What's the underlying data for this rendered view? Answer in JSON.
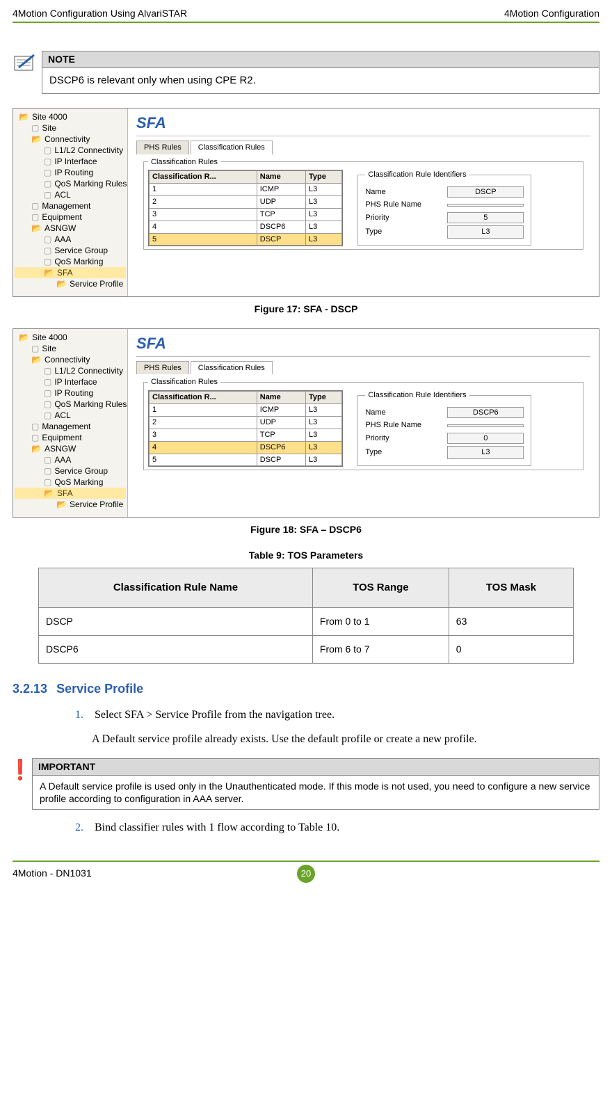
{
  "header": {
    "left": "4Motion Configuration Using AlvariSTAR",
    "right": "4Motion Configuration"
  },
  "note": {
    "title": "NOTE",
    "body": "DSCP6 is relevant only when using CPE R2."
  },
  "figure17": {
    "caption": "Figure 17: SFA - DSCP",
    "title": "SFA",
    "tabs": {
      "t1": "PHS Rules",
      "t2": "Classification Rules"
    },
    "grouplabel": "Classification Rules",
    "tree": {
      "site": "Site 4000",
      "site_item": "Site",
      "conn": "Connectivity",
      "l1l2": "L1/L2 Connectivity",
      "ipif": "IP Interface",
      "iprt": "IP Routing",
      "qosm": "QoS Marking Rules",
      "acl": "ACL",
      "mgmt": "Management",
      "equip": "Equipment",
      "asngw": "ASNGW",
      "aaa": "AAA",
      "sg": "Service Group",
      "qosm2": "QoS Marking",
      "sfa": "SFA",
      "sprof": "Service Profile"
    },
    "cols": {
      "c1": "Classification R...",
      "c2": "Name",
      "c3": "Type"
    },
    "rows": [
      {
        "n": "1",
        "name": "ICMP",
        "type": "L3"
      },
      {
        "n": "2",
        "name": "UDP",
        "type": "L3"
      },
      {
        "n": "3",
        "name": "TCP",
        "type": "L3"
      },
      {
        "n": "4",
        "name": "DSCP6",
        "type": "L3"
      },
      {
        "n": "5",
        "name": "DSCP",
        "type": "L3"
      }
    ],
    "highlight_index": 4,
    "ident": {
      "title": "Classification Rule Identifiers",
      "name_lbl": "Name",
      "name_val": "DSCP",
      "phs_lbl": "PHS Rule Name",
      "phs_val": "",
      "prio_lbl": "Priority",
      "prio_val": "5",
      "type_lbl": "Type",
      "type_val": "L3"
    }
  },
  "figure18": {
    "caption": "Figure 18: SFA – DSCP6",
    "highlight_index": 3,
    "ident_name_val": "DSCP6",
    "ident_prio_val": "0"
  },
  "table9": {
    "caption": "Table 9: TOS Parameters",
    "headers": {
      "h1": "Classification Rule Name",
      "h2": "TOS Range",
      "h3": "TOS Mask"
    },
    "rows": [
      {
        "c1": "DSCP",
        "c2": "From 0 to 1",
        "c3": "63"
      },
      {
        "c1": "DSCP6",
        "c2": "From 6 to 7",
        "c3": "0"
      }
    ]
  },
  "section": {
    "num": "3.2.13",
    "title": "Service Profile"
  },
  "steps": {
    "s1": "Select SFA > Service Profile from the navigation tree.",
    "s1b": "A Default service profile already exists. Use the default profile or create a new profile.",
    "s2": "Bind classifier rules with 1 flow according to Table 10."
  },
  "important": {
    "title": "IMPORTANT",
    "body": "A Default service profile is used only in the Unauthenticated mode. If this mode is not used, you need to configure a new service profile according to configuration in AAA server."
  },
  "footer": {
    "left": "4Motion - DN1031",
    "page": "20"
  }
}
